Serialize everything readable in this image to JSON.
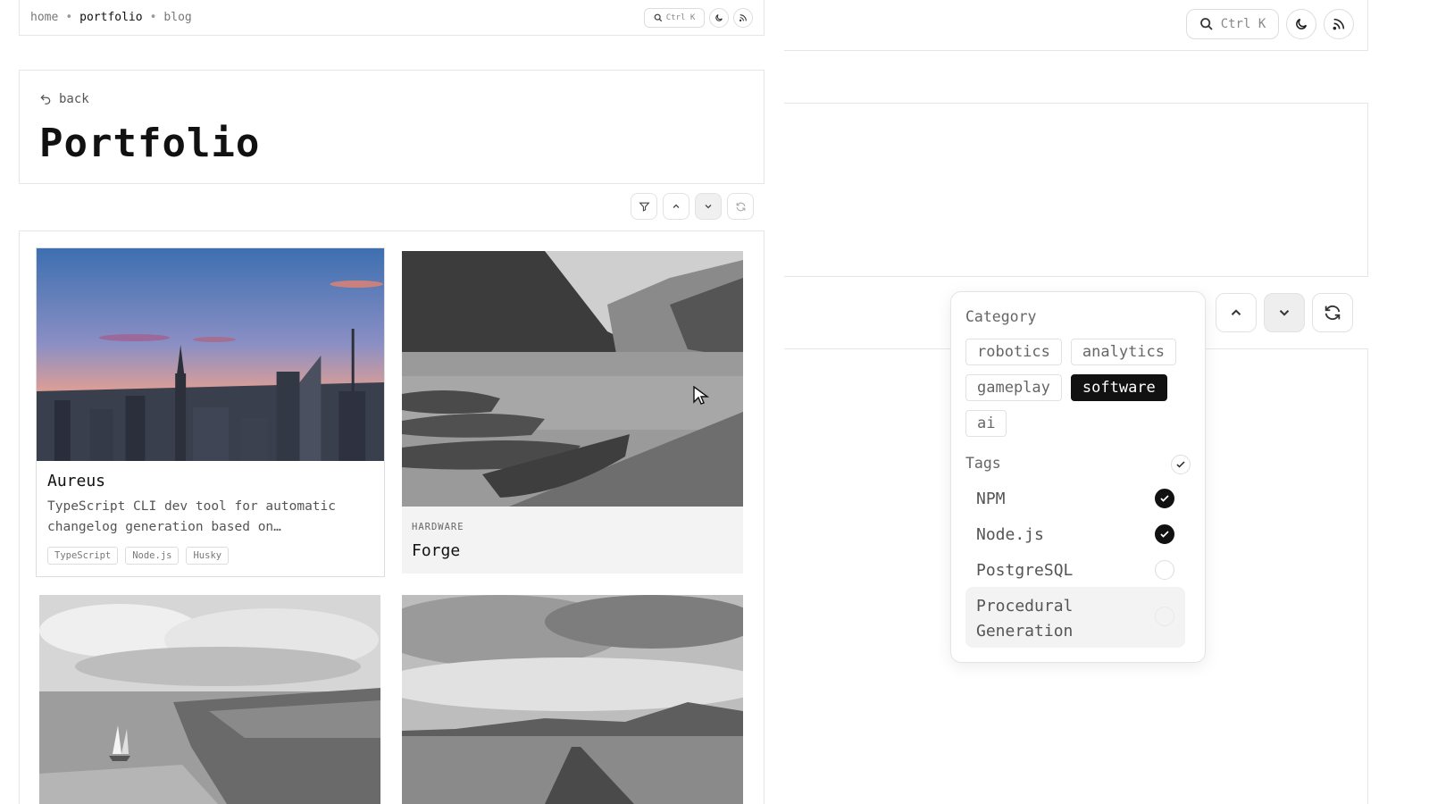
{
  "nav": {
    "crumbs": [
      "home",
      "portfolio",
      "blog"
    ],
    "separator": "•",
    "search_label": "Ctrl K"
  },
  "header": {
    "back_label": "back",
    "title": "Portfolio"
  },
  "projects": [
    {
      "name": "Aureus",
      "description": "TypeScript CLI dev tool for automatic changelog generation based on…",
      "tags": [
        "TypeScript",
        "Node.js",
        "Husky"
      ]
    },
    {
      "kicker": "HARDWARE",
      "name": "Forge"
    }
  ],
  "filter": {
    "category_heading": "Category",
    "categories": [
      {
        "label": "robotics",
        "selected": false
      },
      {
        "label": "analytics",
        "selected": false
      },
      {
        "label": "gameplay",
        "selected": false
      },
      {
        "label": "software",
        "selected": true
      },
      {
        "label": "ai",
        "selected": false
      }
    ],
    "tags_heading": "Tags",
    "tags": [
      {
        "label": "NPM",
        "checked": true
      },
      {
        "label": "Node.js",
        "checked": true
      },
      {
        "label": "PostgreSQL",
        "checked": false
      },
      {
        "label": "Procedural Generation",
        "checked": false
      }
    ]
  },
  "icons": {
    "search": "search-icon",
    "theme": "moon-icon",
    "rss": "rss-icon",
    "filter": "filter-icon",
    "up": "chevron-up-icon",
    "down": "chevron-down-icon",
    "reset": "refresh-icon"
  }
}
